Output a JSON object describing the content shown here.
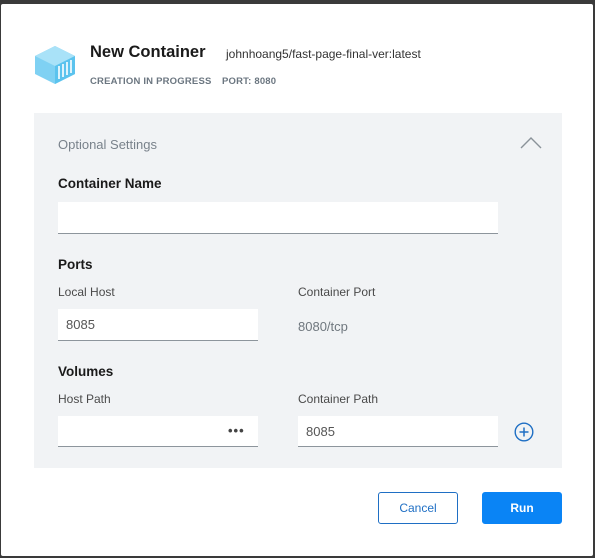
{
  "header": {
    "title": "New Container",
    "image_name": "johnhoang5/fast-page-final-ver:latest",
    "status": "CREATION IN PROGRESS",
    "port": "PORT: 8080",
    "icon": "container-icon"
  },
  "settings": {
    "title": "Optional Settings",
    "collapse_icon": "chevron-up-icon",
    "container_name": {
      "label": "Container Name",
      "value": ""
    },
    "ports": {
      "label": "Ports",
      "local_host_label": "Local Host",
      "local_host_value": "8085",
      "container_port_label": "Container Port",
      "container_port_value": "8080/tcp"
    },
    "volumes": {
      "label": "Volumes",
      "host_path_label": "Host Path",
      "host_path_value": "",
      "browse_label": "•••",
      "container_path_label": "Container Path",
      "container_path_value": "8085",
      "add_icon": "plus-circle-icon"
    }
  },
  "actions": {
    "cancel_label": "Cancel",
    "run_label": "Run"
  },
  "colors": {
    "accent": "#0a84f5",
    "panel_background": "#f1f3f5",
    "icon_blue": "#7fd1f3"
  }
}
